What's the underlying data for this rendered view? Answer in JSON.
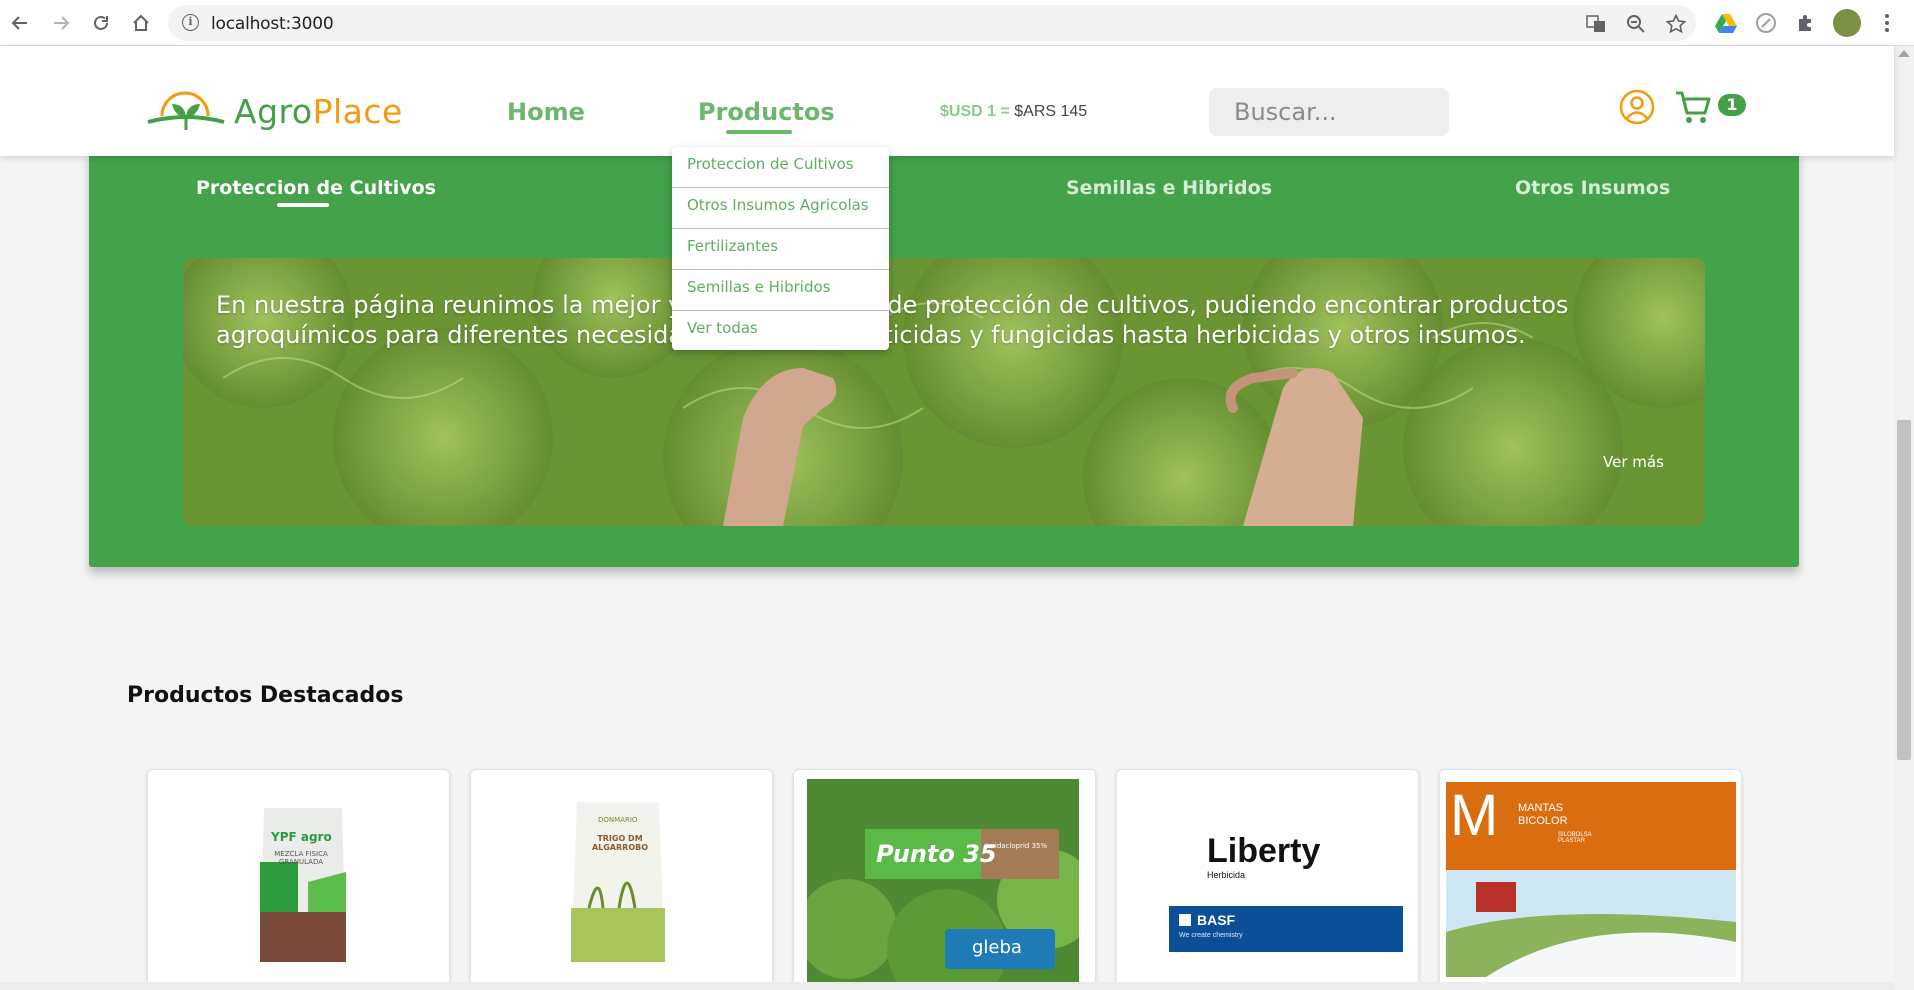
{
  "browser": {
    "url": "localhost:3000",
    "icons": [
      "back-arrow-icon",
      "forward-arrow-icon",
      "reload-icon",
      "home-icon",
      "info-icon",
      "translate-icon",
      "zoom-icon",
      "star-icon",
      "drive-icon",
      "extension-icon",
      "puzzle-icon",
      "profile-avatar",
      "menu-icon"
    ]
  },
  "header": {
    "logo_part1": "Agro",
    "logo_part2": "Place",
    "nav_home": "Home",
    "nav_products": "Productos",
    "rate_usd": "$USD 1 =",
    "rate_ars": "$ARS 145",
    "search_placeholder": "Buscar...",
    "cart_count": "1"
  },
  "dropdown": {
    "items": [
      "Proteccion de Cultivos",
      "Otros Insumos Agricolas",
      "Fertilizantes",
      "Semillas e Hibridos",
      "Ver todas"
    ]
  },
  "categories": {
    "tabs": [
      "Proteccion de Cultivos",
      "Semillas e Hibridos",
      "Otros Insumos"
    ],
    "active": "Proteccion de Cultivos"
  },
  "banner": {
    "text": "En nuestra página reunimos la mejor y mayor variedad de protección de cultivos, pudiendo encontrar productos agroquímicos para diferentes necesidades, desde insecticidas y fungicidas hasta herbicidas y otros insumos.",
    "link": "Ver más"
  },
  "featured": {
    "title": "Productos Destacados",
    "cards": [
      {
        "brand": "YPF agro",
        "label": "MEZCLA FISICA GRANULADA"
      },
      {
        "brand": "DONMARIO",
        "label": "TRIGO DM ALGARROBO"
      },
      {
        "brand": "Punto 35",
        "label": "Imidacloprid 35%",
        "maker": "gleba"
      },
      {
        "brand": "Liberty",
        "label": "Herbicida",
        "maker": "BASF",
        "maker_tag": "We create chemistry"
      },
      {
        "brand": "M",
        "label": "MANTAS BICOLOR",
        "maker": "SILOBOLSA PLASTAR"
      }
    ]
  },
  "colors": {
    "brand_green": "#43a047",
    "brand_orange": "#f39c12",
    "nav_green": "#6cb66d",
    "panel_green": "#43a24a"
  }
}
